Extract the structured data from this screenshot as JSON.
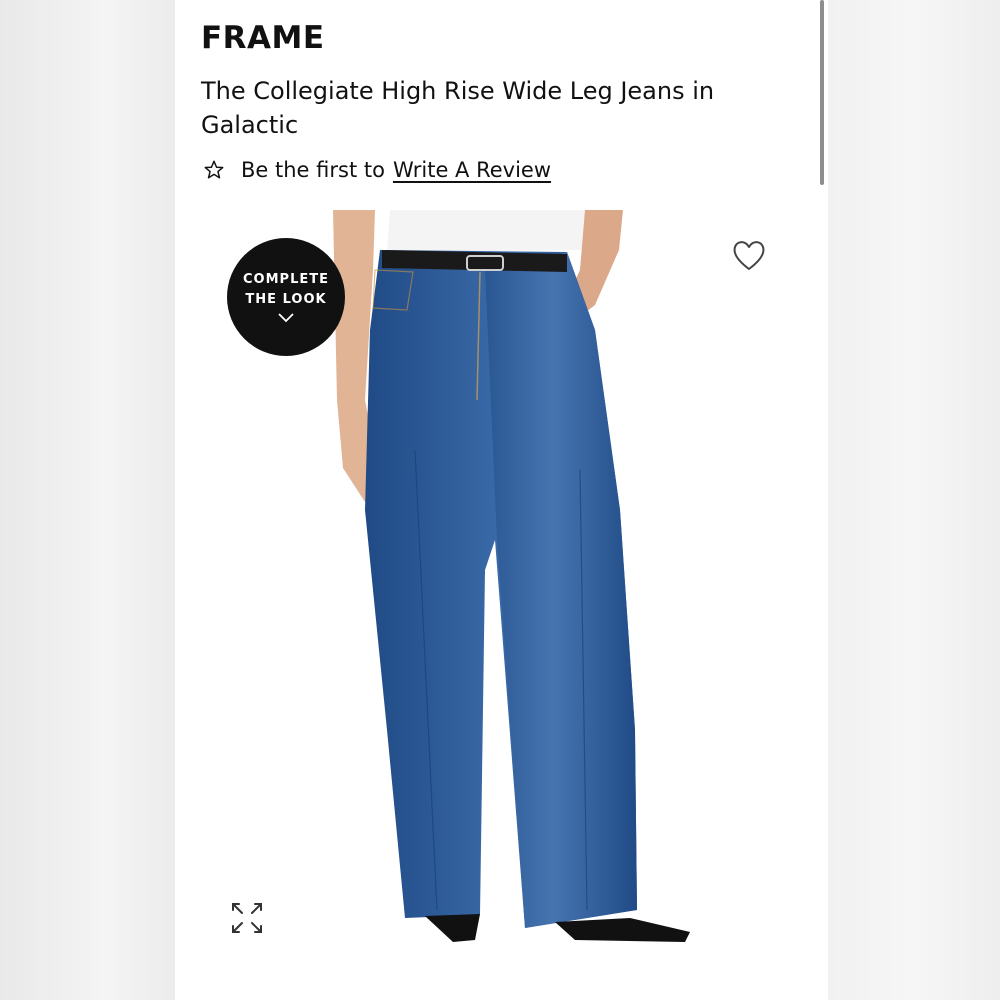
{
  "product": {
    "brand": "FRAME",
    "title": "The Collegiate High Rise Wide Leg Jeans in Galactic"
  },
  "reviews": {
    "prefix": "Be the first to",
    "link_label": "Write A Review",
    "icon": "star-outline-icon"
  },
  "image": {
    "badge_line1": "COMPLETE",
    "badge_line2": "THE LOOK",
    "badge_icon": "chevron-down-icon",
    "wishlist_icon": "heart-outline-icon",
    "expand_icon": "expand-arrows-icon"
  },
  "colors": {
    "badge_bg": "#111111",
    "denim": "#2e5c9a",
    "page_bg": "#ffffff"
  }
}
